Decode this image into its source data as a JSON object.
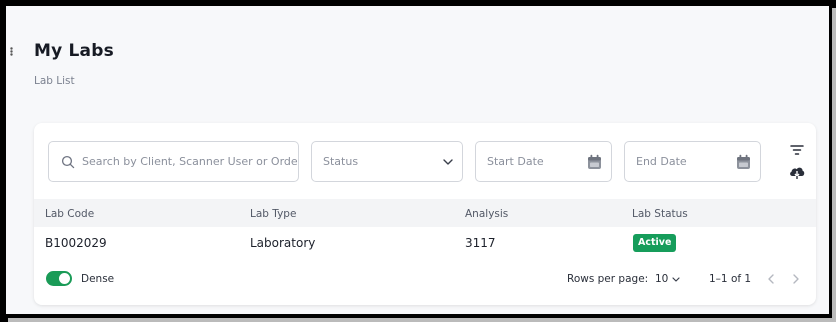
{
  "page": {
    "title": "My Labs",
    "breadcrumb": "Lab List"
  },
  "filters": {
    "search_placeholder": "Search by Client, Scanner User or Order N",
    "status_placeholder": "Status",
    "start_date_placeholder": "Start Date",
    "end_date_placeholder": "End Date"
  },
  "icons": {
    "search": "search-icon",
    "dropdown": "chevron-down-icon",
    "calendar": "calendar-icon",
    "filter": "filter-icon",
    "download": "cloud-download-icon",
    "prev": "chevron-left-icon",
    "next": "chevron-right-icon"
  },
  "table": {
    "columns": [
      "Lab Code",
      "Lab Type",
      "Analysis",
      "Lab Status"
    ],
    "rows": [
      {
        "lab_code": "B1002029",
        "lab_type": "Laboratory",
        "analysis": "3117",
        "lab_status": "Active"
      }
    ]
  },
  "footer": {
    "dense_label": "Dense",
    "dense_on": true,
    "rows_per_page_label": "Rows per page:",
    "rows_per_page_value": "10",
    "range_text": "1–1 of 1"
  },
  "colors": {
    "accent_green": "#169d5b",
    "toggle_green": "#1a9b57",
    "page_bg": "#f7f8fa",
    "header_bg": "#f3f4f6"
  }
}
